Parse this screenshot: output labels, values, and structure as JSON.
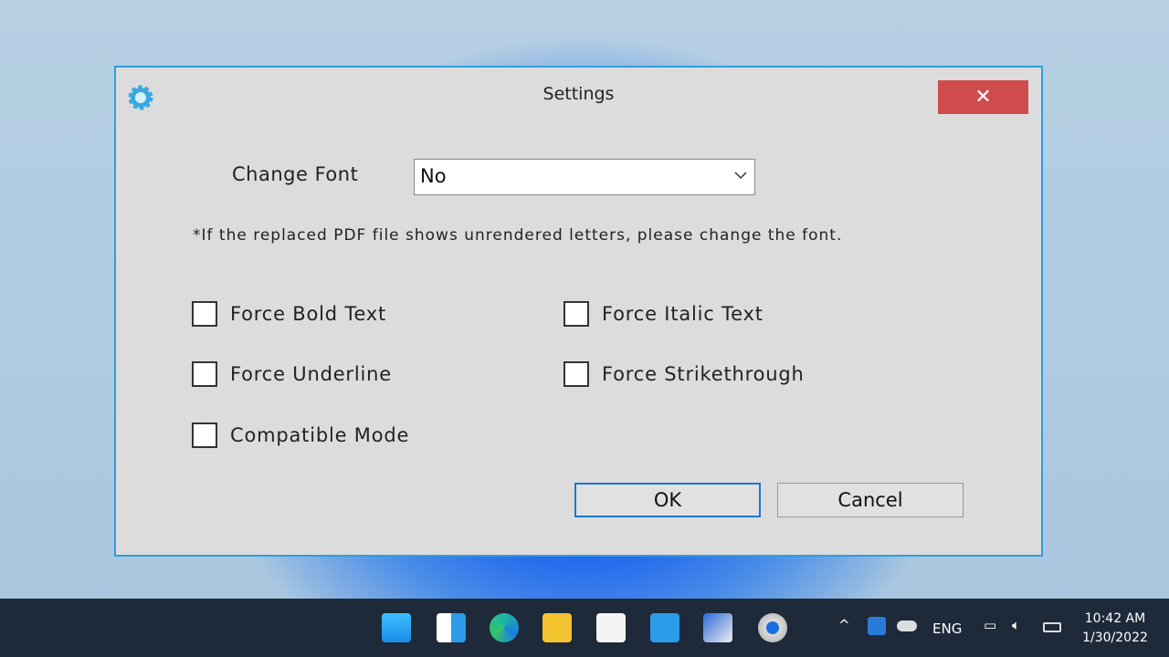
{
  "dialog": {
    "title": "Settings",
    "icon": "gear-icon",
    "close_label": "✕",
    "change_font_label": "Change Font",
    "font_value": "No",
    "note": "*If the replaced PDF file shows unrendered letters, please change the font.",
    "checkboxes": [
      {
        "label": "Force Bold Text",
        "checked": false
      },
      {
        "label": "Force Italic Text",
        "checked": false
      },
      {
        "label": "Force Underline",
        "checked": false
      },
      {
        "label": "Force Strikethrough",
        "checked": false
      },
      {
        "label": "Compatible Mode",
        "checked": false
      }
    ],
    "ok_label": "OK",
    "cancel_label": "Cancel"
  },
  "taskbar": {
    "apps": [
      "start-icon",
      "widgets-icon",
      "edge-icon",
      "file-explorer-icon",
      "store-icon",
      "mail-icon",
      "paint-icon",
      "settings-icon"
    ],
    "language": "ENG",
    "time": "10:42 AM",
    "date": "1/30/2022"
  },
  "colors": {
    "accent": "#2e9ede",
    "close": "#cf4c4c",
    "taskbar": "#1e2a3a"
  }
}
